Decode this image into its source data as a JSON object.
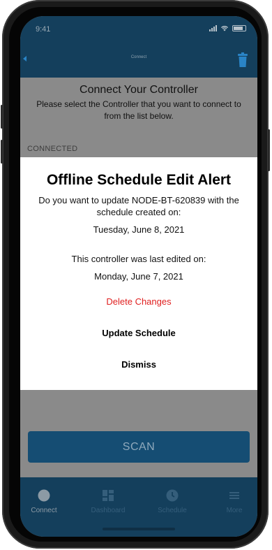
{
  "status_bar": {
    "time": "9:41"
  },
  "header": {
    "title": "Connect"
  },
  "page": {
    "title": "Connect Your Controller",
    "subtitle": "Please select the Controller that you want to connect to from the list below.",
    "section_label": "CONNECTED"
  },
  "alert": {
    "title": "Offline Schedule Edit Alert",
    "message": "Do you want to update NODE-BT-620839 with the schedule created on:",
    "schedule_date": "Tuesday, June 8, 2021",
    "last_edited_text": "This controller was last edited on:",
    "last_edited_date": "Monday, June 7, 2021",
    "buttons": {
      "delete": "Delete Changes",
      "update": "Update Schedule",
      "dismiss": "Dismiss"
    }
  },
  "scan_button": {
    "label": "SCAN"
  },
  "tabs": [
    {
      "label": "Connect",
      "icon": "circle-icon",
      "active": true
    },
    {
      "label": "Dashboard",
      "icon": "grid-icon",
      "active": false
    },
    {
      "label": "Schedule",
      "icon": "clock-icon",
      "active": false
    },
    {
      "label": "More",
      "icon": "menu-icon",
      "active": false
    }
  ],
  "colors": {
    "header_bg": "#143f5c",
    "accent": "#2a84c6",
    "destructive": "#e02020",
    "scan_button_bg": "#154d73"
  }
}
